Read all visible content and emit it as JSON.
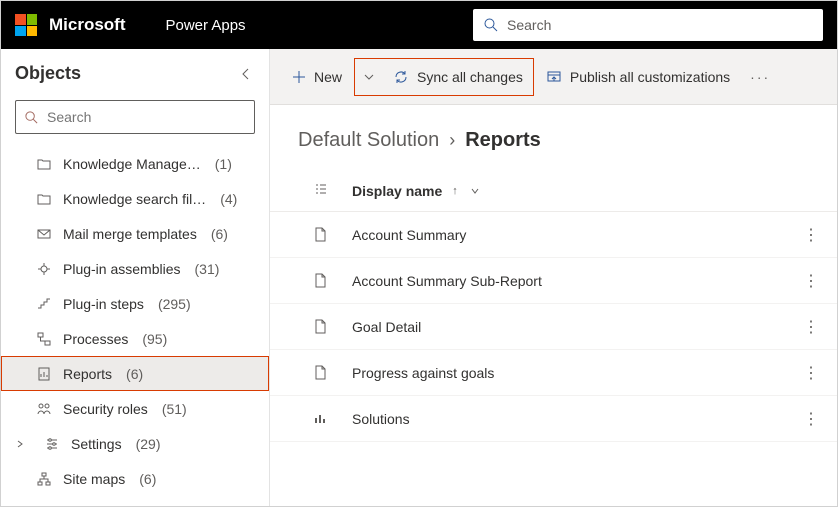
{
  "header": {
    "brand": "Microsoft",
    "app": "Power Apps",
    "search_placeholder": "Search"
  },
  "sidebar": {
    "title": "Objects",
    "search_placeholder": "Search",
    "items": [
      {
        "label": "Knowledge Manage…",
        "count": "(1)",
        "icon": "folder",
        "expandable": false
      },
      {
        "label": "Knowledge search fil…",
        "count": "(4)",
        "icon": "folder",
        "expandable": false
      },
      {
        "label": "Mail merge templates",
        "count": "(6)",
        "icon": "mail-tmpl",
        "expandable": false
      },
      {
        "label": "Plug-in assemblies",
        "count": "(31)",
        "icon": "plug",
        "expandable": false
      },
      {
        "label": "Plug-in steps",
        "count": "(295)",
        "icon": "steps",
        "expandable": false
      },
      {
        "label": "Processes",
        "count": "(95)",
        "icon": "process",
        "expandable": false
      },
      {
        "label": "Reports",
        "count": "(6)",
        "icon": "report",
        "expandable": false,
        "selected": true,
        "highlight": true
      },
      {
        "label": "Security roles",
        "count": "(51)",
        "icon": "roles",
        "expandable": false
      },
      {
        "label": "Settings",
        "count": "(29)",
        "icon": "settings",
        "expandable": true
      },
      {
        "label": "Site maps",
        "count": "(6)",
        "icon": "sitemap",
        "expandable": false
      }
    ]
  },
  "commandbar": {
    "new": "New",
    "sync": "Sync all changes",
    "publish": "Publish all customizations"
  },
  "breadcrumb": {
    "root": "Default Solution",
    "current": "Reports"
  },
  "table": {
    "header": "Display name",
    "rows": [
      {
        "name": "Account Summary",
        "icon": "doc"
      },
      {
        "name": "Account Summary Sub-Report",
        "icon": "doc"
      },
      {
        "name": "Goal Detail",
        "icon": "doc"
      },
      {
        "name": "Progress against goals",
        "icon": "doc"
      },
      {
        "name": "Solutions",
        "icon": "chart"
      }
    ]
  }
}
